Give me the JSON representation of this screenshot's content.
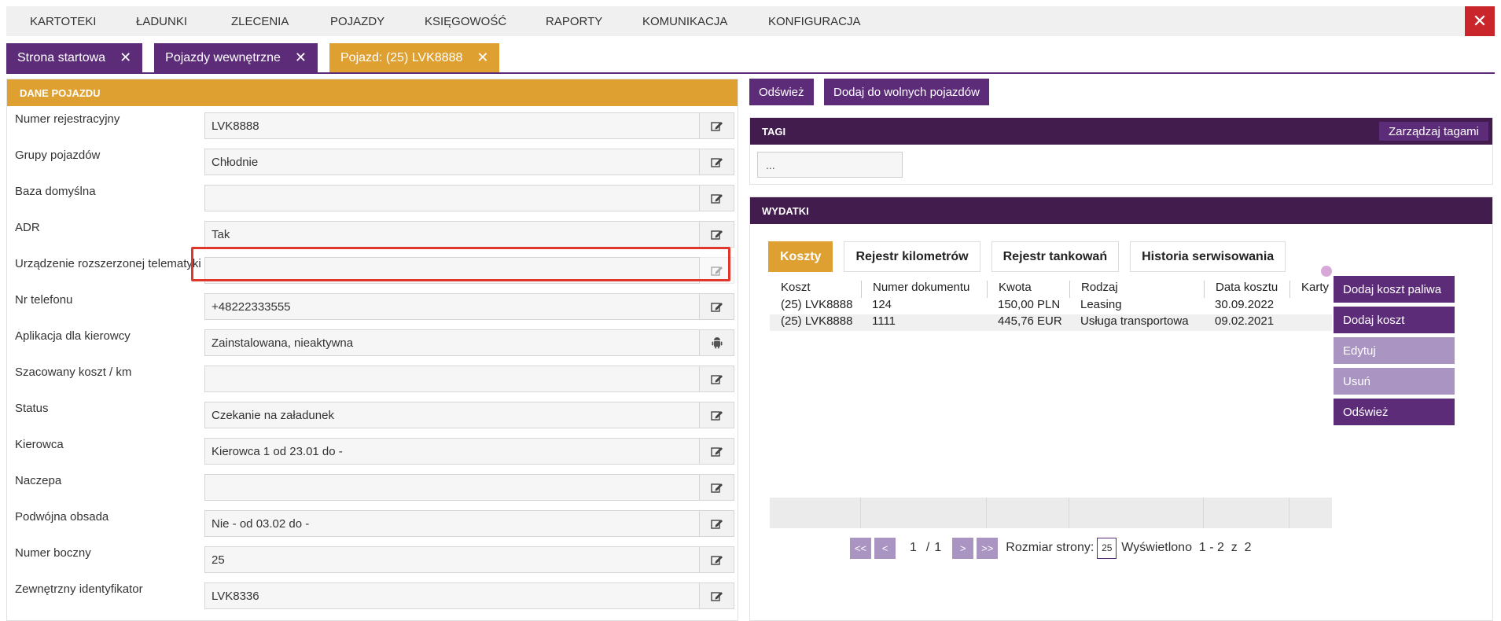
{
  "topnav": {
    "items": [
      "KARTOTEKI",
      "ŁADUNKI",
      "ZLECENIA",
      "POJAZDY",
      "KSIĘGOWOŚĆ",
      "RAPORTY",
      "KOMUNIKACJA",
      "KONFIGURACJA"
    ],
    "close_icon": "close-icon"
  },
  "tabs": [
    {
      "label": "Strona startowa"
    },
    {
      "label": "Pojazdy wewnętrzne"
    },
    {
      "label": "Pojazd: (25) LVK8888"
    }
  ],
  "vehicle_panel": {
    "title": "DANE POJAZDU",
    "fields": [
      {
        "label": "Numer rejestracyjny",
        "value": "LVK8888",
        "icon": "edit-icon"
      },
      {
        "label": "Grupy pojazdów",
        "value": "Chłodnie",
        "icon": "edit-icon"
      },
      {
        "label": "Baza domyślna",
        "value": "",
        "icon": "edit-icon"
      },
      {
        "label": "ADR",
        "value": "Tak",
        "icon": "edit-icon"
      },
      {
        "label": "Urządzenie rozszerzonej telematyki",
        "value": "",
        "icon": "edit-icon"
      },
      {
        "label": "Nr telefonu",
        "value": "+48222333555",
        "icon": "edit-icon"
      },
      {
        "label": "Aplikacja dla kierowcy",
        "value": "Zainstalowana, nieaktywna",
        "icon": "android-icon"
      },
      {
        "label": "Szacowany koszt / km",
        "value": "",
        "icon": "edit-icon"
      },
      {
        "label": "Status",
        "value": "Czekanie na załadunek",
        "icon": "edit-icon"
      },
      {
        "label": "Kierowca",
        "value": "Kierowca 1 od 23.01 do  -",
        "icon": "edit-icon"
      },
      {
        "label": "Naczepa",
        "value": "",
        "icon": "edit-icon"
      },
      {
        "label": "Podwójna obsada",
        "value": "Nie -  od 03.02 do  -",
        "icon": "edit-icon"
      },
      {
        "label": "Numer boczny",
        "value": "25",
        "icon": "edit-icon"
      },
      {
        "label": "Zewnętrzny identyfikator",
        "value": "LVK8336",
        "icon": "edit-icon"
      }
    ]
  },
  "actions": {
    "refresh": "Odśwież",
    "add_free": "Dodaj do wolnych pojazdów"
  },
  "tags": {
    "title": "TAGI",
    "manage": "Zarządzaj tagami",
    "input_value": "..."
  },
  "expenses": {
    "title": "WYDATKI",
    "tabs": [
      "Koszty",
      "Rejestr kilometrów",
      "Rejestr tankowań",
      "Historia serwisowania"
    ],
    "columns": [
      "Koszt",
      "Numer dokumentu",
      "Kwota",
      "Rodzaj",
      "Data kosztu",
      "Karty"
    ],
    "rows": [
      [
        "(25) LVK8888",
        "124",
        "150,00 PLN",
        "Leasing",
        "30.09.2022",
        ""
      ],
      [
        "(25) LVK8888",
        "1111",
        "445,76 EUR",
        "Usługa transportowa",
        "09.02.2021",
        ""
      ]
    ],
    "side_buttons": [
      "Dodaj koszt paliwa",
      "Dodaj koszt",
      "Edytuj",
      "Usuń",
      "Odśwież"
    ],
    "pager": {
      "first": "<<",
      "prev": "<",
      "page": "1",
      "sep": "/",
      "total_pages": "1",
      "next": ">",
      "last": ">>",
      "page_size_label": "Rozmiar strony:",
      "page_size": "25",
      "display": "Wyświetlono  1 - 2  z  2"
    }
  },
  "colors": {
    "purple": "#5c2c79",
    "dark_purple": "#431c4e",
    "orange": "#dfa032",
    "red": "#c9262c",
    "disabled_purple": "#a994c2",
    "highlight": "#e0362b"
  }
}
